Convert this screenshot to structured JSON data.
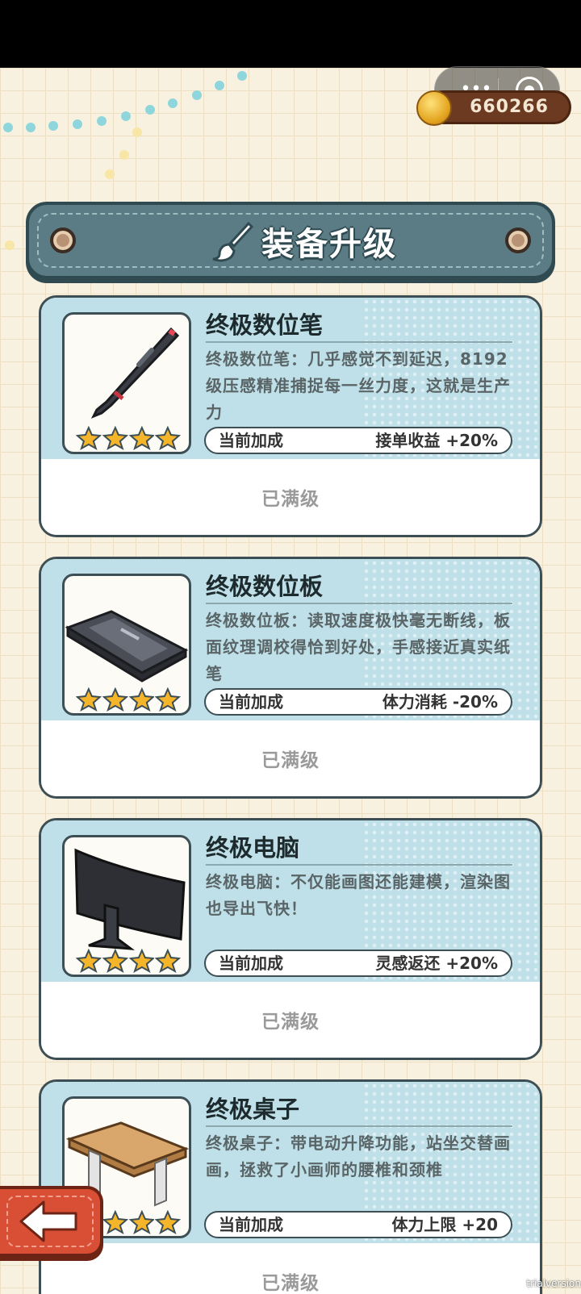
{
  "header": {
    "coin_count": "660266",
    "more_label": "•••",
    "coin_icon": "gold-coin-icon"
  },
  "title": {
    "text": "装备升级",
    "icon": "paintbrush-icon"
  },
  "cards": [
    {
      "name": "终极数位笔",
      "description": "终极数位笔：几乎感觉不到延迟，8192级压感精准捕捉每一丝力度，这就是生产力",
      "bonus_label": "当前加成",
      "bonus_value": "接单收益 +20%",
      "stars": 4,
      "status": "已满级",
      "icon": "digital-pen-icon"
    },
    {
      "name": "终极数位板",
      "description": "终极数位板：读取速度极快毫无断线，板面纹理调校得恰到好处，手感接近真实纸笔",
      "bonus_label": "当前加成",
      "bonus_value": "体力消耗 -20%",
      "stars": 4,
      "status": "已满级",
      "icon": "drawing-tablet-icon"
    },
    {
      "name": "终极电脑",
      "description": "终极电脑：不仅能画图还能建模，渲染图也导出飞快！",
      "bonus_label": "当前加成",
      "bonus_value": "灵感返还 +20%",
      "stars": 4,
      "status": "已满级",
      "icon": "curved-monitor-icon"
    },
    {
      "name": "终极桌子",
      "description": "终极桌子：带电动升降功能，站坐交替画画，拯救了小画师的腰椎和颈椎",
      "bonus_label": "当前加成",
      "bonus_value": "体力上限 +20",
      "stars": 4,
      "status": "已满级",
      "icon": "standing-desk-icon"
    }
  ],
  "footer": {
    "back_icon": "back-arrow-icon",
    "watermark": "trialversion"
  },
  "colors": {
    "accent": "#5b7c84",
    "card_top": "#bfe0e8",
    "back_button": "#d94f36",
    "star": "#f5b52a"
  }
}
